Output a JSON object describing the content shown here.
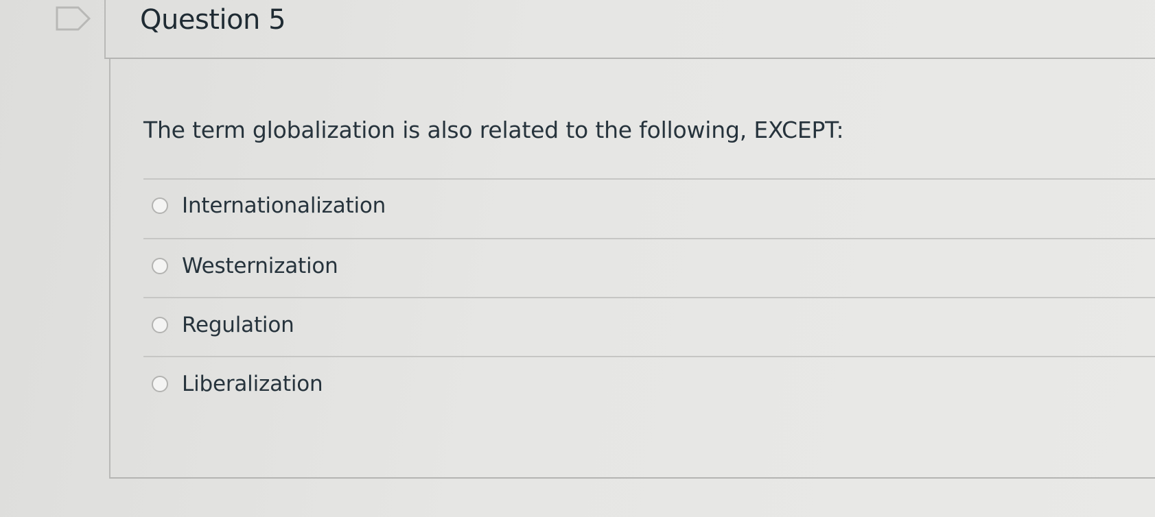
{
  "question": {
    "title": "Question 5",
    "text": "The term globalization is also related to the following, EXCEPT:",
    "answers": [
      {
        "label": "Internationalization"
      },
      {
        "label": "Westernization"
      },
      {
        "label": "Regulation"
      },
      {
        "label": "Liberalization"
      }
    ]
  },
  "icons": {
    "flag": "flag-question-icon",
    "radio": "radio-unchecked-icon"
  },
  "colors": {
    "background": "#e4e4e2",
    "text": "#26333c",
    "border": "#b4b4b2"
  }
}
